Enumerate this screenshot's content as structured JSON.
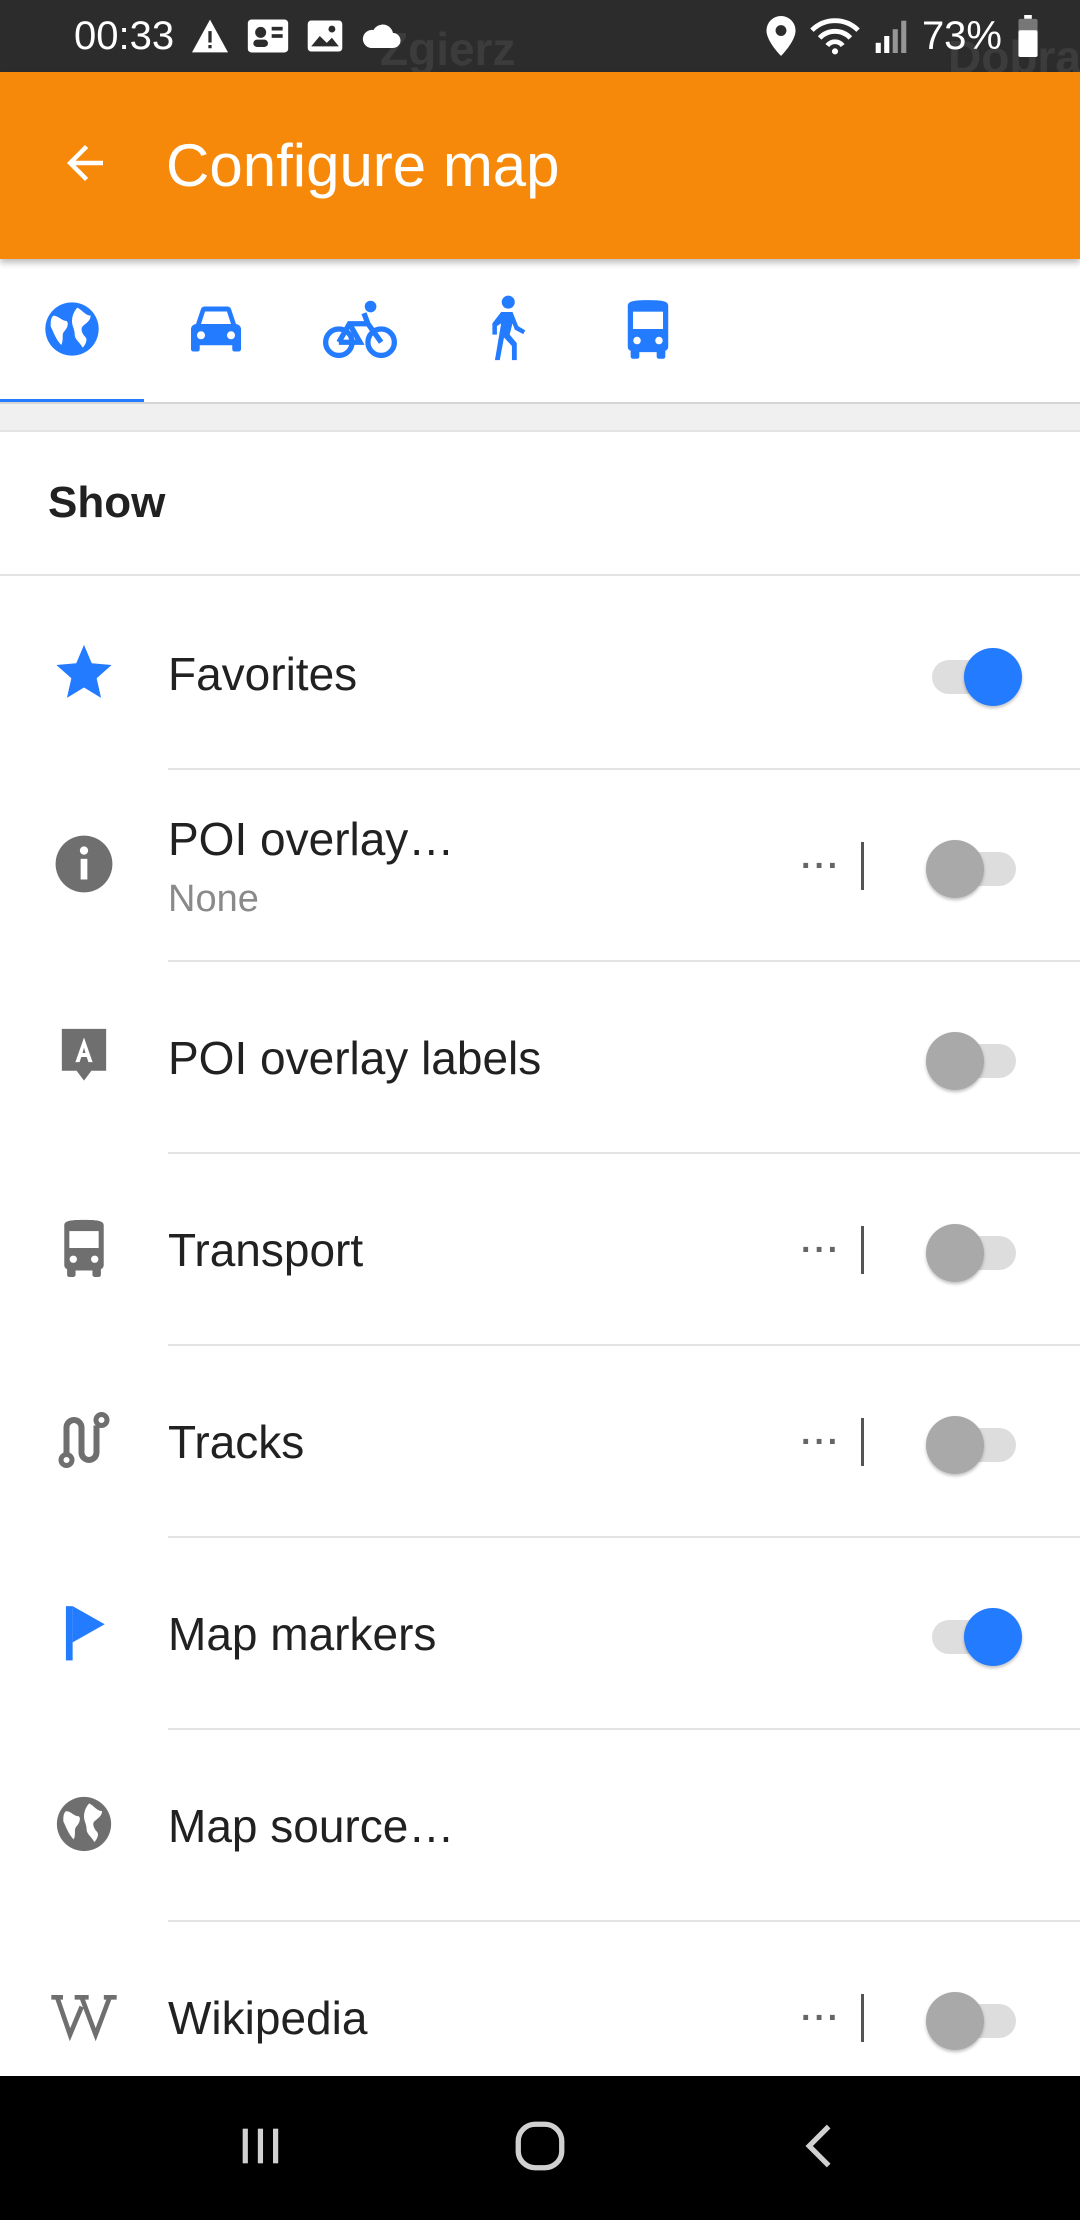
{
  "status_bar": {
    "time": "00:33",
    "battery": "73%",
    "background_map_labels": [
      "Zgierz",
      "Dobra"
    ]
  },
  "app_bar": {
    "title": "Configure map",
    "back_icon": "arrow-left-icon",
    "background": "#f6890a"
  },
  "profile_tabs": [
    {
      "name": "browse-map",
      "icon": "globe-icon",
      "active": true
    },
    {
      "name": "car",
      "icon": "car-icon",
      "active": false
    },
    {
      "name": "bicycle",
      "icon": "bicycle-icon",
      "active": false
    },
    {
      "name": "pedestrian",
      "icon": "walk-icon",
      "active": false
    },
    {
      "name": "public-transport",
      "icon": "bus-icon",
      "active": false
    }
  ],
  "section": {
    "title": "Show"
  },
  "items": [
    {
      "title": "Favorites",
      "subtitle": "",
      "icon": "star-icon",
      "has_more": false,
      "has_switch": true,
      "on": true
    },
    {
      "title": "POI overlay…",
      "subtitle": "None",
      "icon": "info-icon",
      "has_more": true,
      "has_switch": true,
      "on": false
    },
    {
      "title": "POI overlay labels",
      "subtitle": "",
      "icon": "label-icon",
      "has_more": false,
      "has_switch": true,
      "on": false
    },
    {
      "title": "Transport",
      "subtitle": "",
      "icon": "bus-icon",
      "has_more": true,
      "has_switch": true,
      "on": false
    },
    {
      "title": "Tracks",
      "subtitle": "",
      "icon": "track-icon",
      "has_more": true,
      "has_switch": true,
      "on": false
    },
    {
      "title": "Map markers",
      "subtitle": "",
      "icon": "flag-icon",
      "has_more": false,
      "has_switch": true,
      "on": true
    },
    {
      "title": "Map source…",
      "subtitle": "",
      "icon": "globe-icon",
      "has_more": false,
      "has_switch": false,
      "on": false
    },
    {
      "title": "Wikipedia",
      "subtitle": "",
      "icon": "wikipedia-icon",
      "has_more": true,
      "has_switch": true,
      "on": false
    }
  ],
  "more_label": "···",
  "colors": {
    "accent": "#237bff",
    "toolbar": "#f6890a",
    "icon_gray": "#6f6f6f"
  },
  "nav_bar": {
    "buttons": [
      "recent-apps-icon",
      "home-icon",
      "back-icon"
    ]
  }
}
